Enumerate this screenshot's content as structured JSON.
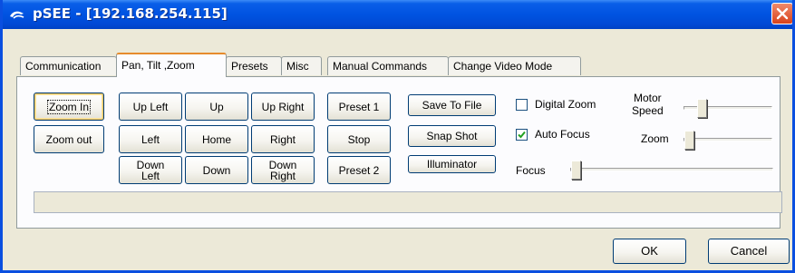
{
  "window": {
    "title": "pSEE - [192.168.254.115]",
    "titlebar_color": "#0053e1",
    "icon": "app-logo-icon"
  },
  "tabs": [
    {
      "label": "Communication",
      "active": false
    },
    {
      "label": "Pan, Tilt ,Zoom",
      "active": true
    },
    {
      "label": "Presets",
      "active": false
    },
    {
      "label": "Misc",
      "active": false
    },
    {
      "label": "Manual Commands",
      "active": false
    },
    {
      "label": "Change Video Mode",
      "active": false
    }
  ],
  "ptz": {
    "zoom_in": "Zoom In",
    "zoom_out": "Zoom out",
    "up_left": "Up Left",
    "up": "Up",
    "up_right": "Up Right",
    "left": "Left",
    "home": "Home",
    "right": "Right",
    "down_left": "Down\nLeft",
    "down": "Down",
    "down_right": "Down\nRight"
  },
  "presets": {
    "preset1": "Preset 1",
    "stop": "Stop",
    "preset2": "Preset 2"
  },
  "actions": {
    "save_to_file": "Save To File",
    "snap_shot": "Snap Shot",
    "illuminator": "Illuminator"
  },
  "options": {
    "digital_zoom": {
      "label": "Digital Zoom",
      "checked": false
    },
    "auto_focus": {
      "label": "Auto Focus",
      "checked": true
    }
  },
  "sliders": {
    "motor_speed": {
      "label": "Motor\nSpeed"
    },
    "zoom": {
      "label": "Zoom"
    },
    "focus": {
      "label": "Focus"
    }
  },
  "status_text": "",
  "footer": {
    "ok": "OK",
    "cancel": "Cancel"
  }
}
